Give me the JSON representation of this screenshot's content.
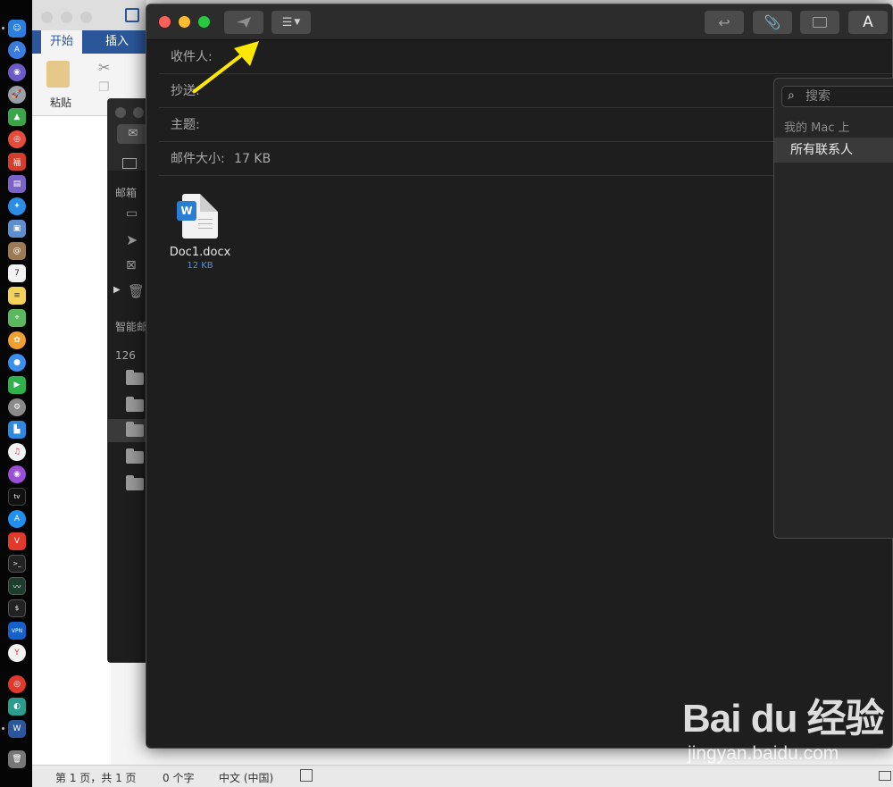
{
  "word": {
    "tab_home": "开始",
    "tab_insert": "插入",
    "paste_label": "粘贴",
    "status_page": "第 1 页，共 1 页",
    "status_words": "0 个字",
    "status_lang": "中文 (中国)"
  },
  "mail_main": {
    "mailboxes_label": "邮箱",
    "smart_label": "智能邮",
    "count": "126"
  },
  "compose": {
    "to_label": "收件人:",
    "cc_label": "抄送:",
    "subject_label": "主题:",
    "size_label": "邮件大小:",
    "size_value": "17 KB",
    "font_button": "A",
    "attachment": {
      "name": "Doc1.docx",
      "size": "12 KB",
      "icon_letter": "W"
    }
  },
  "contacts": {
    "search_placeholder": "搜索",
    "group_header": "我的 Mac 上",
    "selected_item": "所有联系人"
  },
  "dock": {
    "calendar_day": "7",
    "tv_label": "tv",
    "vpn_label": "VPN"
  },
  "watermark": {
    "brand": "Bai du 经验",
    "url": "jingyan.baidu.com"
  },
  "colors": {
    "accent_word": "#2b579a",
    "attachment_size": "#4a90e2",
    "arrow": "#ffe800",
    "traffic_red": "#fe5f57",
    "traffic_yellow": "#febc2e",
    "traffic_green": "#28c840"
  }
}
